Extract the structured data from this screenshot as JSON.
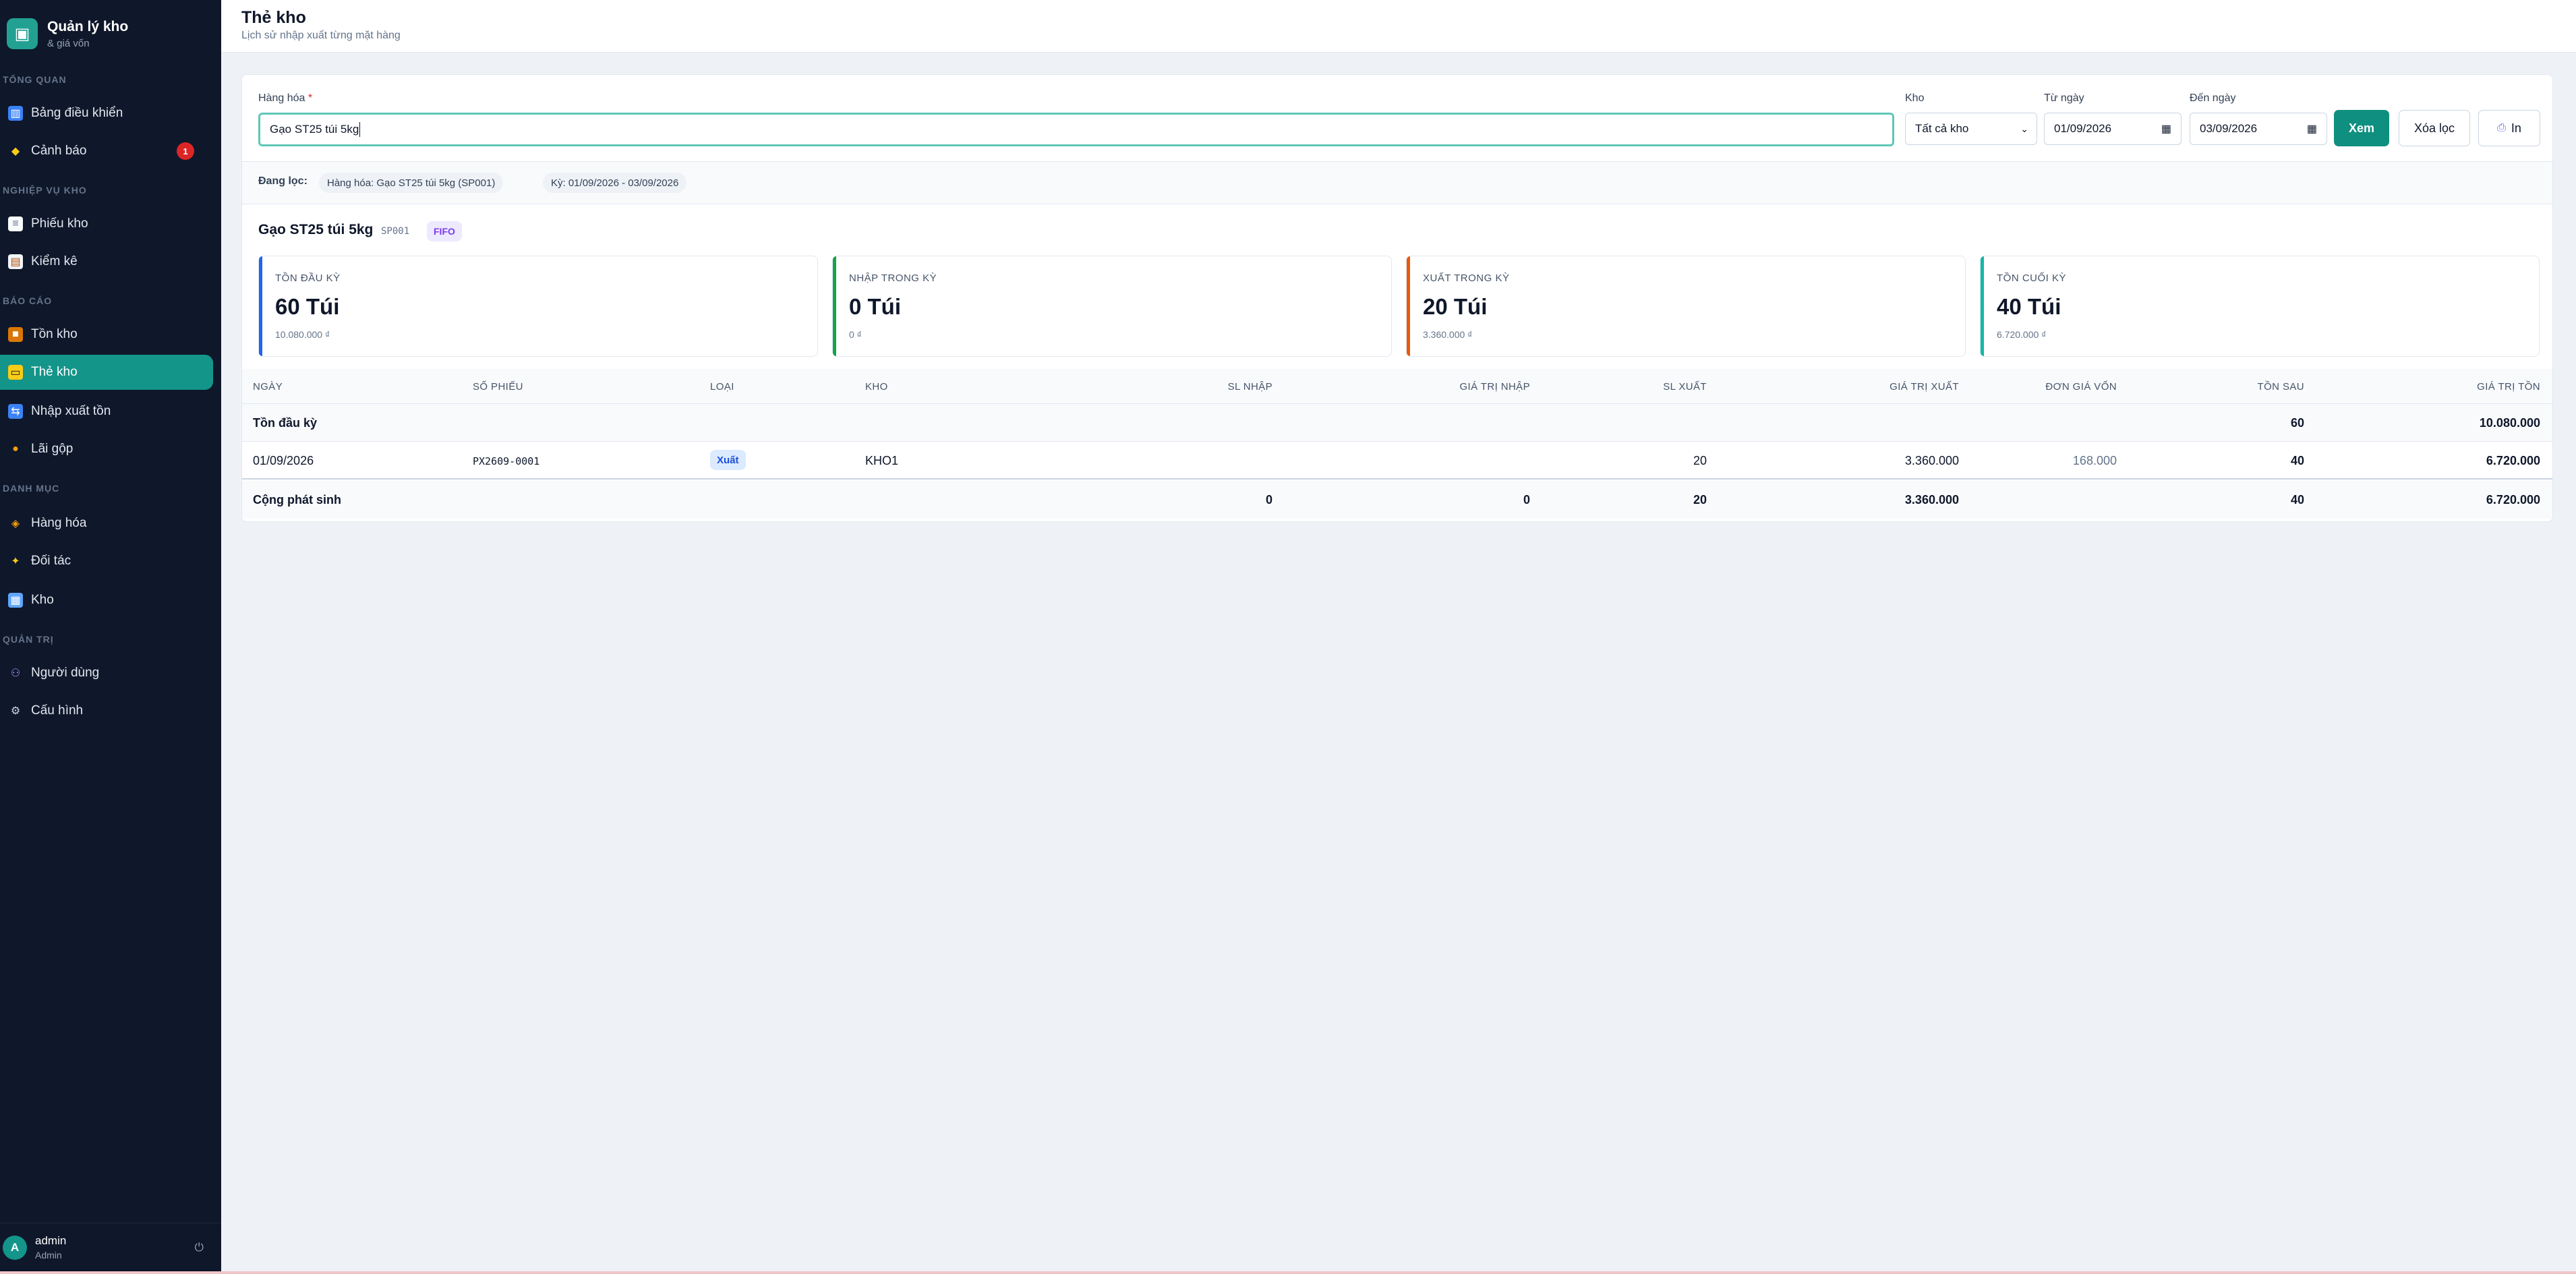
{
  "brand": {
    "title": "Quản lý kho",
    "subtitle": "& giá vốn",
    "icon": "box-icon"
  },
  "sidebar": {
    "sections": [
      {
        "title": "TỔNG QUAN"
      },
      {
        "title": "NGHIỆP VỤ KHO"
      },
      {
        "title": "BÁO CÁO"
      },
      {
        "title": "DANH MỤC"
      },
      {
        "title": "QUẢN TRỊ"
      }
    ],
    "items": [
      {
        "label": "Bảng điều khiển",
        "icon": "chart-icon"
      },
      {
        "label": "Cảnh báo",
        "icon": "bell-icon",
        "badge": "1"
      },
      {
        "label": "Phiếu kho",
        "icon": "receipt-icon"
      },
      {
        "label": "Kiểm kê",
        "icon": "clipboard-icon"
      },
      {
        "label": "Tồn kho",
        "icon": "package-icon"
      },
      {
        "label": "Thẻ kho",
        "icon": "card-icon",
        "active": true
      },
      {
        "label": "Nhập xuất tồn",
        "icon": "swap-icon"
      },
      {
        "label": "Lãi gộp",
        "icon": "money-bag-icon"
      },
      {
        "label": "Hàng hóa",
        "icon": "tag-icon"
      },
      {
        "label": "Đối tác",
        "icon": "handshake-icon"
      },
      {
        "label": "Kho",
        "icon": "warehouse-icon"
      },
      {
        "label": "Người dùng",
        "icon": "users-icon"
      },
      {
        "label": "Cấu hình",
        "icon": "gear-icon"
      }
    ]
  },
  "user": {
    "initial": "A",
    "name": "admin",
    "role": "Admin"
  },
  "header": {
    "title": "Thẻ kho",
    "subtitle": "Lịch sử nhập xuất từng mặt hàng"
  },
  "filters": {
    "product_label": "Hàng hóa",
    "required_mark": "*",
    "product_value": "Gạo ST25 túi 5kg",
    "warehouse_label": "Kho",
    "warehouse_value": "Tất cả kho",
    "from_label": "Từ ngày",
    "from_value": "01/09/2026",
    "to_label": "Đến ngày",
    "to_value": "03/09/2026",
    "view_button": "Xem",
    "clear_button": "Xóa lọc",
    "print_button": "In"
  },
  "active_filters": {
    "label": "Đang lọc:",
    "chips": [
      "Hàng hóa: Gạo ST25 túi 5kg (SP001)",
      "Kỳ: 01/09/2026 - 03/09/2026"
    ]
  },
  "product": {
    "name": "Gạo ST25 túi 5kg",
    "code": "SP001",
    "method": "FIFO"
  },
  "stats": [
    {
      "label": "TỒN ĐẦU KỲ",
      "value": "60 Túi",
      "sub": "10.080.000 ₫",
      "color": "#2563eb"
    },
    {
      "label": "NHẬP TRONG KỲ",
      "value": "0 Túi",
      "sub": "0 ₫",
      "color": "#16a34a"
    },
    {
      "label": "XUẤT TRONG KỲ",
      "value": "20 Túi",
      "sub": "3.360.000 ₫",
      "color": "#ea580c"
    },
    {
      "label": "TỒN CUỐI KỲ",
      "value": "40 Túi",
      "sub": "6.720.000 ₫",
      "color": "#14b8a6"
    }
  ],
  "table": {
    "columns": [
      "NGÀY",
      "SỐ PHIẾU",
      "LOẠI",
      "KHO",
      "SL NHẬP",
      "GIÁ TRỊ NHẬP",
      "SL XUẤT",
      "GIÁ TRỊ XUẤT",
      "ĐƠN GIÁ VỐN",
      "TỒN SAU",
      "GIÁ TRỊ TỒN"
    ],
    "opening": {
      "label": "Tồn đầu kỳ",
      "ton_sau": "60",
      "gia_tri_ton": "10.080.000"
    },
    "rows": [
      {
        "ngay": "01/09/2026",
        "so_phieu": "PX2609-0001",
        "loai": "Xuất",
        "kho": "KHO1",
        "sl_xuat": "20",
        "gia_tri_xuat": "3.360.000",
        "don_gia_von": "168.000",
        "ton_sau": "40",
        "gia_tri_ton": "6.720.000"
      }
    ],
    "total": {
      "label": "Cộng phát sinh",
      "sl_nhap": "0",
      "gia_tri_nhap": "0",
      "sl_xuat": "20",
      "gia_tri_xuat": "3.360.000",
      "ton_sau": "40",
      "gia_tri_ton": "6.720.000"
    }
  }
}
